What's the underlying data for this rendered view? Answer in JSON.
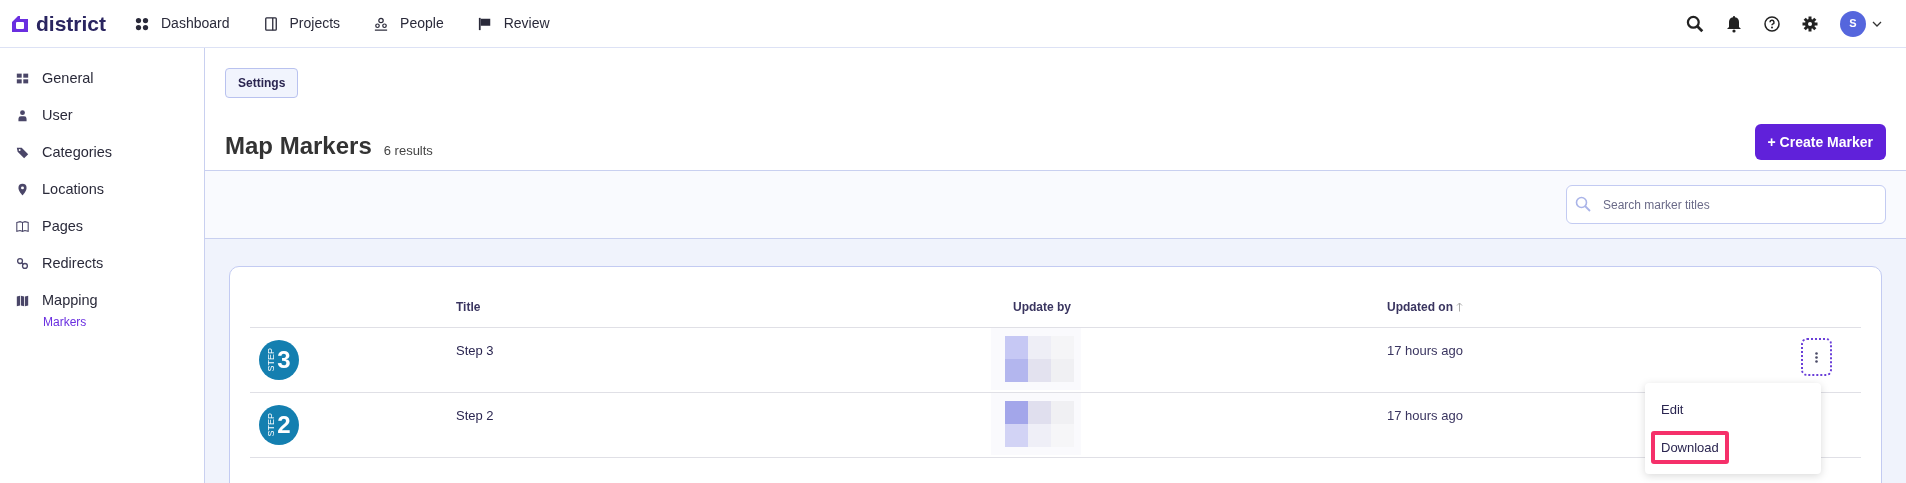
{
  "brand": "district",
  "nav": [
    {
      "label": "Dashboard"
    },
    {
      "label": "Projects"
    },
    {
      "label": "People"
    },
    {
      "label": "Review"
    }
  ],
  "user": {
    "initial": "S"
  },
  "sidebar": {
    "items": [
      {
        "label": "General"
      },
      {
        "label": "User"
      },
      {
        "label": "Categories"
      },
      {
        "label": "Locations"
      },
      {
        "label": "Pages"
      },
      {
        "label": "Redirects"
      },
      {
        "label": "Mapping",
        "children": [
          {
            "label": "Markers",
            "selected": true
          }
        ]
      }
    ]
  },
  "breadcrumb": "Settings",
  "title": "Map Markers",
  "result_count": "6 results",
  "create_button": "+ Create Marker",
  "search": {
    "placeholder": "Search marker titles"
  },
  "table": {
    "columns": [
      "Title",
      "Update by",
      "Updated on"
    ],
    "rows": [
      {
        "marker_label": "STEP",
        "marker_number": "3",
        "title": "Step 3",
        "updated_on": "17 hours ago",
        "menu_open": true
      },
      {
        "marker_label": "STEP",
        "marker_number": "2",
        "title": "Step 2",
        "updated_on": "17 hours ago",
        "menu_open": false
      }
    ]
  },
  "row_menu": {
    "items": [
      {
        "label": "Edit",
        "highlighted": false
      },
      {
        "label": "Download",
        "highlighted": true
      }
    ]
  }
}
